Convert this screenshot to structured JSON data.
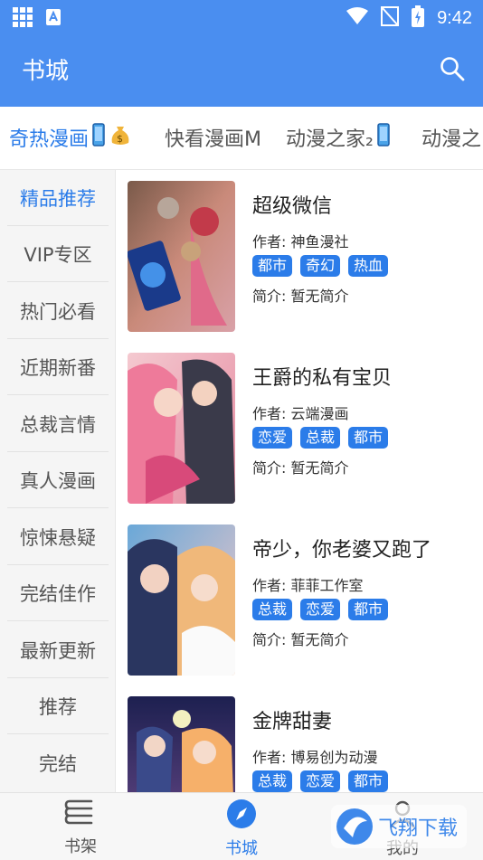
{
  "status_bar": {
    "time": "9:42"
  },
  "app_bar": {
    "title": "书城"
  },
  "top_tabs": [
    {
      "label": "奇热漫画",
      "active": true
    },
    {
      "label": "快看漫画M",
      "active": false
    },
    {
      "label": "动漫之家₂",
      "active": false
    },
    {
      "label": "动漫之",
      "active": false
    }
  ],
  "sidebar": {
    "items": [
      {
        "label": "精品推荐",
        "active": true
      },
      {
        "label": "VIP专区",
        "active": false
      },
      {
        "label": "热门必看",
        "active": false
      },
      {
        "label": "近期新番",
        "active": false
      },
      {
        "label": "总裁言情",
        "active": false
      },
      {
        "label": "真人漫画",
        "active": false
      },
      {
        "label": "惊悚悬疑",
        "active": false
      },
      {
        "label": "完结佳作",
        "active": false
      },
      {
        "label": "最新更新",
        "active": false
      },
      {
        "label": "推荐",
        "active": false
      },
      {
        "label": "完结",
        "active": false
      }
    ]
  },
  "books": [
    {
      "title": "超级微信",
      "author": "作者: 神鱼漫社",
      "tags": [
        "都市",
        "奇幻",
        "热血"
      ],
      "intro": "简介: 暂无简介"
    },
    {
      "title": "王爵的私有宝贝",
      "author": "作者: 云端漫画",
      "tags": [
        "恋爱",
        "总裁",
        "都市"
      ],
      "intro": "简介: 暂无简介"
    },
    {
      "title": "帝少，你老婆又跑了",
      "author": "作者: 菲菲工作室",
      "tags": [
        "总裁",
        "恋爱",
        "都市"
      ],
      "intro": "简介: 暂无简介"
    },
    {
      "title": "金牌甜妻",
      "author": "作者: 博易创为动漫",
      "tags": [
        "总裁",
        "恋爱",
        "都市"
      ],
      "intro": ""
    }
  ],
  "bottom_nav": [
    {
      "label": "书架",
      "icon": "bookshelf-icon",
      "active": false
    },
    {
      "label": "书城",
      "icon": "compass-icon",
      "active": true
    },
    {
      "label": "我的",
      "icon": "profile-icon",
      "active": false
    }
  ],
  "watermark": {
    "text": "飞翔下载"
  },
  "colors": {
    "primary": "#4a8ef0",
    "accent": "#2b7ce9"
  }
}
